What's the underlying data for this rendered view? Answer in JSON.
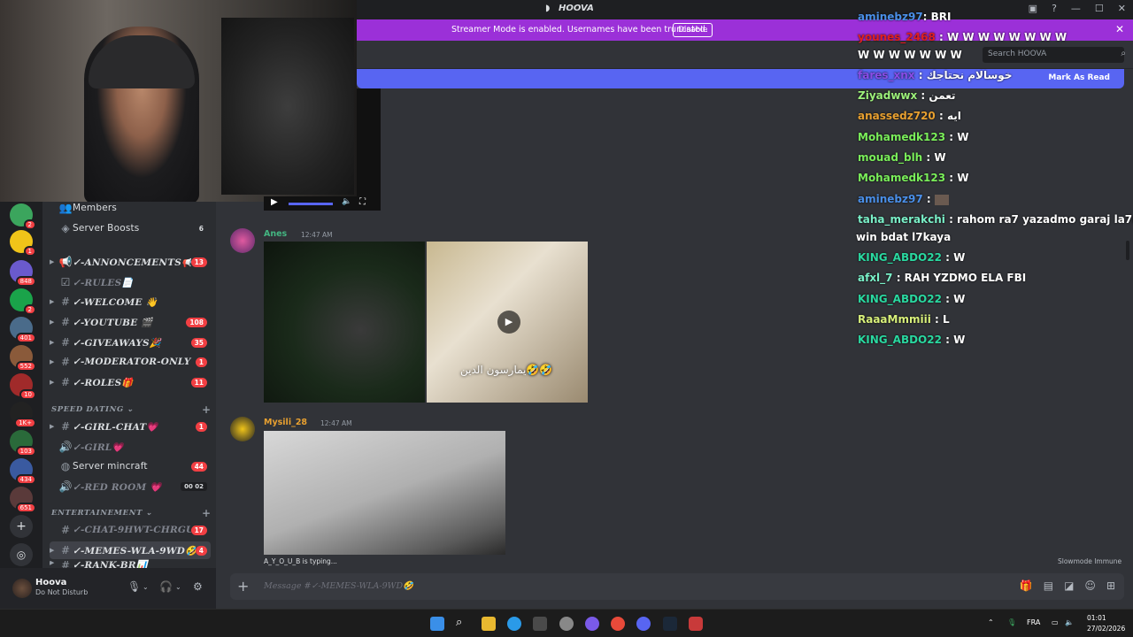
{
  "window": {
    "title": "HOOVA",
    "controls": [
      "—",
      "☐",
      "✕"
    ]
  },
  "banner": {
    "text": "Streamer Mode is enabled. Usernames have been truncated.",
    "button": "Disable"
  },
  "search": {
    "placeholder": "Search HOOVA"
  },
  "new_messages": {
    "mark_read": "Mark As Read"
  },
  "sidebar": {
    "members_label": "Members",
    "boosts": {
      "label": "Server Boosts",
      "count": "6"
    },
    "channels": [
      {
        "name": "✓-ANNONCEMENTS📢",
        "count": "13"
      },
      {
        "name": "✓-RULES📄",
        "count": ""
      },
      {
        "name": "✓-WELCOME 👋",
        "count": ""
      },
      {
        "name": "✓-YOUTUBE 🎬",
        "count": "108"
      },
      {
        "name": "✓-GIVEAWAYS🎉",
        "count": "35"
      },
      {
        "name": "✓-MODERATOR-ONLY",
        "count": "1"
      },
      {
        "name": "✓-ROLES🎁",
        "count": "11"
      }
    ],
    "cat_speed": "SPEED DATING",
    "speed_channels": [
      {
        "name": "✓-GIRL-CHAT💗",
        "count": "1"
      },
      {
        "name": "✓-GIRL💗",
        "count": ""
      },
      {
        "name": "Server mincraft",
        "count": "44"
      },
      {
        "name": "✓-RED ROOM 💗",
        "count": "00 02"
      }
    ],
    "cat_ent": "ENTERTAINEMENT",
    "ent_channels": [
      {
        "name": "✓-CHAT-9HWT-CHRGUI",
        "count": "17"
      },
      {
        "name": "✓-MEMES-WLA-9WD🤣",
        "count": "4"
      },
      {
        "name": "✓-RANK-BR📊",
        "count": ""
      }
    ]
  },
  "rail_badges": [
    "2",
    "1",
    "848",
    "2",
    "401",
    "552",
    "10",
    "1K+",
    "103",
    "434",
    "651"
  ],
  "user": {
    "name": "Hoova",
    "status": "Do Not Disturb"
  },
  "messages": [
    {
      "user": "Anes",
      "time": "12:47 AM",
      "caption": "يمارسون الدين🤣🤣"
    },
    {
      "user": "Mysili_28",
      "time": "12:47 AM"
    }
  ],
  "typing": "A_Y_O_U_B is typing...",
  "slowmode": "Slowmode Immune",
  "input": {
    "placeholder": "Message #✓-MEMES-WLA-9WD🤣"
  },
  "stream_chat": [
    {
      "user": "aminebz97",
      "msg": ": BRI",
      "color": "#4a8fe8"
    },
    {
      "user": "younes_2468",
      "msg": " : W W W W W W W W",
      "color": "#e02020"
    },
    {
      "user": "",
      "msg": "W  W W W W W W",
      "color": "#ffffff"
    },
    {
      "user": "fares_xnx",
      "msg": " : خوسالام نحتاجك",
      "color": "#8a4de8"
    },
    {
      "user": "Ziyadwwx",
      "msg": " : تعمن",
      "color": "#9cf07a"
    },
    {
      "user": "anassedz720",
      "msg": " : ايه",
      "color": "#e8a030"
    },
    {
      "user": "Mohamedk123",
      "msg": " : W",
      "color": "#7aee5a"
    },
    {
      "user": "mouad_blh",
      "msg": " : W",
      "color": "#7aee5a"
    },
    {
      "user": "Mohamedk123",
      "msg": " : W",
      "color": "#7aee5a"
    },
    {
      "user": "aminebz97",
      "msg": " : ",
      "color": "#4a8fe8"
    },
    {
      "user": "taha_merakchi",
      "msg": " : rahom ra7 yazadmo garaj la7mar",
      "color": "#7af0c8"
    },
    {
      "user": "",
      "msg": "win bdat l7kaya",
      "color": "#ffffff"
    },
    {
      "user": "KING_ABDO22",
      "msg": " : W",
      "color": "#2ad8a0"
    },
    {
      "user": "afxl_7",
      "msg": " : RAH YZDMO ELA FBI",
      "color": "#7af0c8"
    },
    {
      "user": "KING_ABDO22",
      "msg": " : W",
      "color": "#2ad8a0"
    },
    {
      "user": "RaaaMmmiii",
      "msg": " : L",
      "color": "#d8f07a"
    },
    {
      "user": "KING_ABDO22",
      "msg": " : W",
      "color": "#2ad8a0"
    }
  ],
  "taskbar": {
    "lang": "FRA",
    "time": "01:01",
    "date": "27/02/2026"
  }
}
